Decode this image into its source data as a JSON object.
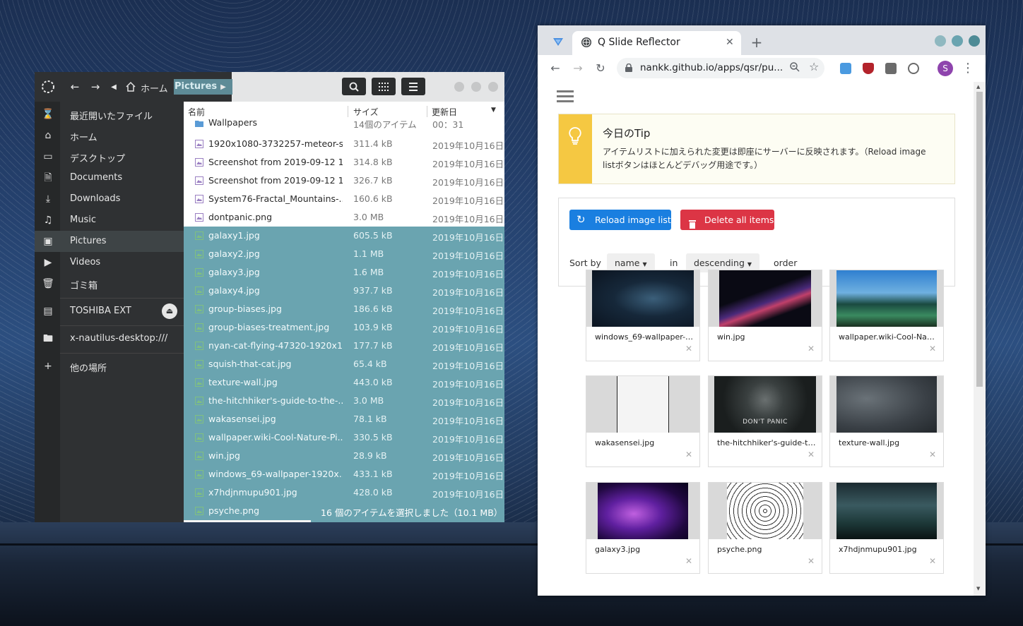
{
  "files": {
    "breadcrumb": {
      "home": "ホーム",
      "current": "Pictures"
    },
    "columns": {
      "name": "名前",
      "size": "サイズ",
      "modified": "更新日"
    },
    "sidebar": [
      {
        "icon": "recent-icon",
        "label": "最近開いたファイル"
      },
      {
        "icon": "home-icon",
        "label": "ホーム"
      },
      {
        "icon": "desktop-icon",
        "label": "デスクトップ"
      },
      {
        "icon": "document-icon",
        "label": "Documents"
      },
      {
        "icon": "download-icon",
        "label": "Downloads"
      },
      {
        "icon": "music-icon",
        "label": "Music"
      },
      {
        "icon": "pictures-icon",
        "label": "Pictures"
      },
      {
        "icon": "video-icon",
        "label": "Videos"
      },
      {
        "icon": "trash-icon",
        "label": "ゴミ箱"
      }
    ],
    "devices": [
      {
        "icon": "drive-icon",
        "label": "TOSHIBA EXT"
      },
      {
        "icon": "folder-icon",
        "label": "x-nautilus-desktop:///"
      },
      {
        "icon": "plus-icon",
        "label": "他の場所"
      }
    ],
    "rows": [
      {
        "name": "Wallpapers",
        "size": "14個のアイテム",
        "date": "00：31",
        "type": "folder",
        "selected": false
      },
      {
        "name": "1920x1080-3732257-meteor-s...",
        "size": "311.4 kB",
        "date": "2019年10月16日",
        "type": "image",
        "selected": false
      },
      {
        "name": "Screenshot from 2019-09-12 1...",
        "size": "314.8 kB",
        "date": "2019年10月16日",
        "type": "image",
        "selected": false
      },
      {
        "name": "Screenshot from 2019-09-12 1...",
        "size": "326.7 kB",
        "date": "2019年10月16日",
        "type": "image",
        "selected": false
      },
      {
        "name": "System76-Fractal_Mountains-...",
        "size": "160.6 kB",
        "date": "2019年10月16日",
        "type": "image",
        "selected": false
      },
      {
        "name": "dontpanic.png",
        "size": "3.0 MB",
        "date": "2019年10月16日",
        "type": "image",
        "selected": false
      },
      {
        "name": "galaxy1.jpg",
        "size": "605.5 kB",
        "date": "2019年10月16日",
        "type": "image",
        "selected": true
      },
      {
        "name": "galaxy2.jpg",
        "size": "1.1 MB",
        "date": "2019年10月16日",
        "type": "image",
        "selected": true
      },
      {
        "name": "galaxy3.jpg",
        "size": "1.6 MB",
        "date": "2019年10月16日",
        "type": "image",
        "selected": true
      },
      {
        "name": "galaxy4.jpg",
        "size": "937.7 kB",
        "date": "2019年10月16日",
        "type": "image",
        "selected": true
      },
      {
        "name": "group-biases.jpg",
        "size": "186.6 kB",
        "date": "2019年10月16日",
        "type": "image",
        "selected": true
      },
      {
        "name": "group-biases-treatment.jpg",
        "size": "103.9 kB",
        "date": "2019年10月16日",
        "type": "image",
        "selected": true
      },
      {
        "name": "nyan-cat-flying-47320-1920x1...",
        "size": "177.7 kB",
        "date": "2019年10月16日",
        "type": "image",
        "selected": true
      },
      {
        "name": "squish-that-cat.jpg",
        "size": "65.4 kB",
        "date": "2019年10月16日",
        "type": "image",
        "selected": true
      },
      {
        "name": "texture-wall.jpg",
        "size": "443.0 kB",
        "date": "2019年10月16日",
        "type": "image",
        "selected": true
      },
      {
        "name": "the-hitchhiker's-guide-to-the-...",
        "size": "3.0 MB",
        "date": "2019年10月16日",
        "type": "image",
        "selected": true
      },
      {
        "name": "wakasensei.jpg",
        "size": "78.1 kB",
        "date": "2019年10月16日",
        "type": "image",
        "selected": true
      },
      {
        "name": "wallpaper.wiki-Cool-Nature-Pi...",
        "size": "330.5 kB",
        "date": "2019年10月16日",
        "type": "image",
        "selected": true
      },
      {
        "name": "win.jpg",
        "size": "28.9 kB",
        "date": "2019年10月16日",
        "type": "image",
        "selected": true
      },
      {
        "name": "windows_69-wallpaper-1920x...",
        "size": "433.1 kB",
        "date": "2019年10月16日",
        "type": "image",
        "selected": true
      },
      {
        "name": "x7hdjnmupu901.jpg",
        "size": "428.0 kB",
        "date": "2019年10月16日",
        "type": "image",
        "selected": true
      },
      {
        "name": "psyche.png",
        "size": "",
        "date": "",
        "type": "image",
        "selected": true
      }
    ],
    "status": "16 個のアイテムを選択しました（10.1 MB）"
  },
  "browser": {
    "tab_title": "Q Slide Reflector",
    "url": "nankk.github.io/apps/qsr/pu...",
    "profile_initial": "S",
    "tip": {
      "title": "今日のTip",
      "body": "アイテムリストに加えられた変更は即座にサーバーに反映されます。（Reload image listボタンはほとんどデバッグ用途です。）"
    },
    "buttons": {
      "reload": "Reload image list",
      "delete_all": "Delete all items"
    },
    "sort": {
      "sort_by": "Sort by",
      "field": "name",
      "in": "in",
      "direction": "descending",
      "order": "order"
    },
    "thumbs": [
      {
        "name": "windows_69-wallpaper-1...",
        "style": "win69"
      },
      {
        "name": "win.jpg",
        "style": "win"
      },
      {
        "name": "wallpaper.wiki-Cool-Natu...",
        "style": "nature"
      },
      {
        "name": "wakasensei.jpg",
        "style": "manga"
      },
      {
        "name": "the-hitchhiker's-guide-to-...",
        "style": "panic",
        "overlay": "DON'T PANIC"
      },
      {
        "name": "texture-wall.jpg",
        "style": "texture"
      },
      {
        "name": "galaxy3.jpg",
        "style": "galaxy"
      },
      {
        "name": "psyche.png",
        "style": "psyche"
      },
      {
        "name": "x7hdjnmupu901.jpg",
        "style": "house"
      }
    ],
    "remove_glyph": "✕"
  },
  "colors": {
    "selection": "#6aa4b0",
    "reload_button": "#1a7fe0",
    "delete_button": "#dc3545",
    "tip_accent": "#f5c842"
  }
}
